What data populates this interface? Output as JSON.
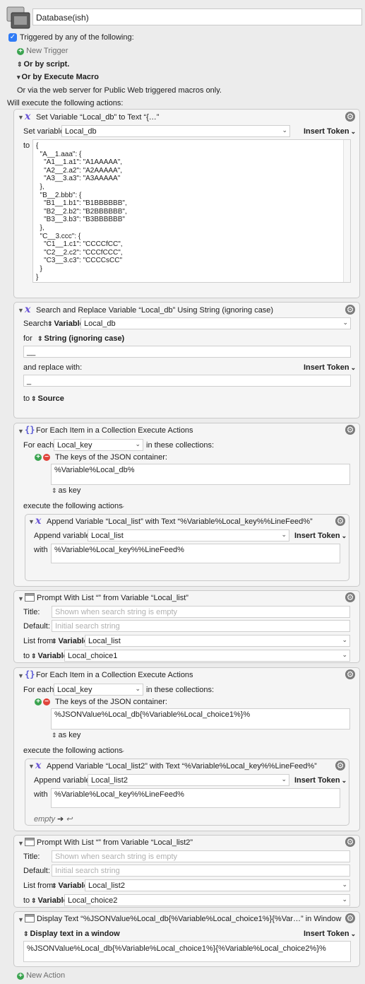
{
  "macro": {
    "name": "Database(ish)"
  },
  "trigger": {
    "triggered_label": "Triggered by any of the following:",
    "new_trigger": "New Trigger",
    "or_script": "Or by script.",
    "or_execute": "Or by Execute Macro",
    "web_server": "Or via the web server for Public Web triggered macros only.",
    "will_execute": "Will execute the following actions:"
  },
  "actions": [
    {
      "title": "Set Variable “Local_db” to Text “{…”",
      "set_label": "Set variable",
      "var_value": "Local_db",
      "insert_token": "Insert Token",
      "to_label": "to",
      "text_value": "{\n  \"A__1.aaa\": {\n    \"A1__1.a1\": \"A1AAAAA\",\n    \"A2__2.a2\": \"A2AAAAA\",\n    \"A3__3.a3\": \"A3AAAAA\"\n  },\n  \"B__2.bbb\": {\n    \"B1__1.b1\": \"B1BBBBBB\",\n    \"B2__2.b2\": \"B2BBBBBB\",\n    \"B3__3.b3\": \"B3BBBBBB\"\n  },\n  \"C__3.ccc\": {\n    \"C1__1.c1\": \"CCCCfCC\",\n    \"C2__2.c2\": \"CCCfCCC\",\n    \"C3__3.c3\": \"CCCCsCC\"\n  }\n}"
    },
    {
      "title": "Search and Replace Variable “Local_db” Using String (ignoring case)",
      "search_label": "Search",
      "search_type": "Variable",
      "search_value": "Local_db",
      "for_label": "for",
      "for_type": "String (ignoring case)",
      "for_value": "__",
      "replace_label": "and replace with:",
      "insert_token": "Insert Token",
      "replace_value": "_",
      "to_label": "to",
      "to_value": "Source"
    },
    {
      "title": "For Each Item in a Collection Execute Actions",
      "for_each_label": "For each",
      "for_each_value": "Local_key",
      "in_label": "in these collections:",
      "collection_label": "The keys of the JSON container:",
      "collection_value": "%Variable%Local_db%",
      "as_key": "as key",
      "execute_label": "execute the following actions",
      "inner": {
        "title": "Append Variable “Local_list” with Text “%Variable%Local_key%%LineFeed%”",
        "append_label": "Append variable",
        "append_value": "Local_list",
        "insert_token": "Insert Token",
        "with_label": "with",
        "with_value": "%Variable%Local_key%%LineFeed%"
      }
    },
    {
      "title": "Prompt With List “” from Variable “Local_list”",
      "title_label": "Title:",
      "title_placeholder": "Shown when search string is empty",
      "default_label": "Default:",
      "default_placeholder": "Initial search string",
      "list_from_label": "List from",
      "list_from_type": "Variable",
      "list_from_value": "Local_list",
      "to_label": "to",
      "to_type": "Variable",
      "to_value": "Local_choice1"
    },
    {
      "title": "For Each Item in a Collection Execute Actions",
      "for_each_label": "For each",
      "for_each_value": "Local_key",
      "in_label": "in these collections:",
      "collection_label": "The keys of the JSON container:",
      "collection_value": "%JSONValue%Local_db{%Variable%Local_choice1%}%",
      "as_key": "as key",
      "execute_label": "execute the following actions",
      "inner": {
        "title": "Append Variable “Local_list2” with Text “%Variable%Local_key%%LineFeed%”",
        "append_label": "Append variable",
        "append_value": "Local_list2",
        "insert_token": "Insert Token",
        "with_label": "with",
        "with_value": "%Variable%Local_key%%LineFeed%",
        "empty_label": "empty"
      }
    },
    {
      "title": "Prompt With List “” from Variable “Local_list2”",
      "title_label": "Title:",
      "title_placeholder": "Shown when search string is empty",
      "default_label": "Default:",
      "default_placeholder": "Initial search string",
      "list_from_label": "List from",
      "list_from_type": "Variable",
      "list_from_value": "Local_list2",
      "to_label": "to",
      "to_type": "Variable",
      "to_value": "Local_choice2"
    },
    {
      "title": "Display Text “%JSONValue%Local_db{%Variable%Local_choice1%}{%Var…” in Window",
      "display_mode": "Display text in a window",
      "insert_token": "Insert Token",
      "text_value": "%JSONValue%Local_db{%Variable%Local_choice1%}{%Variable%Local_choice2%}%"
    }
  ],
  "new_action": "New Action",
  "colors": {
    "accent": "#2f7bf6",
    "variable_icon": "#6a54d8",
    "add_green": "#3aa34f",
    "remove_red": "#e0443b"
  },
  "icons": [
    "macro-icon",
    "checkbox-icon",
    "plus-circle-icon",
    "minus-circle-icon",
    "variable-x-icon",
    "json-braces-icon",
    "gear-icon",
    "window-icon",
    "chevron-down-icon",
    "updown-icon",
    "disclosure-triangle-icon"
  ]
}
